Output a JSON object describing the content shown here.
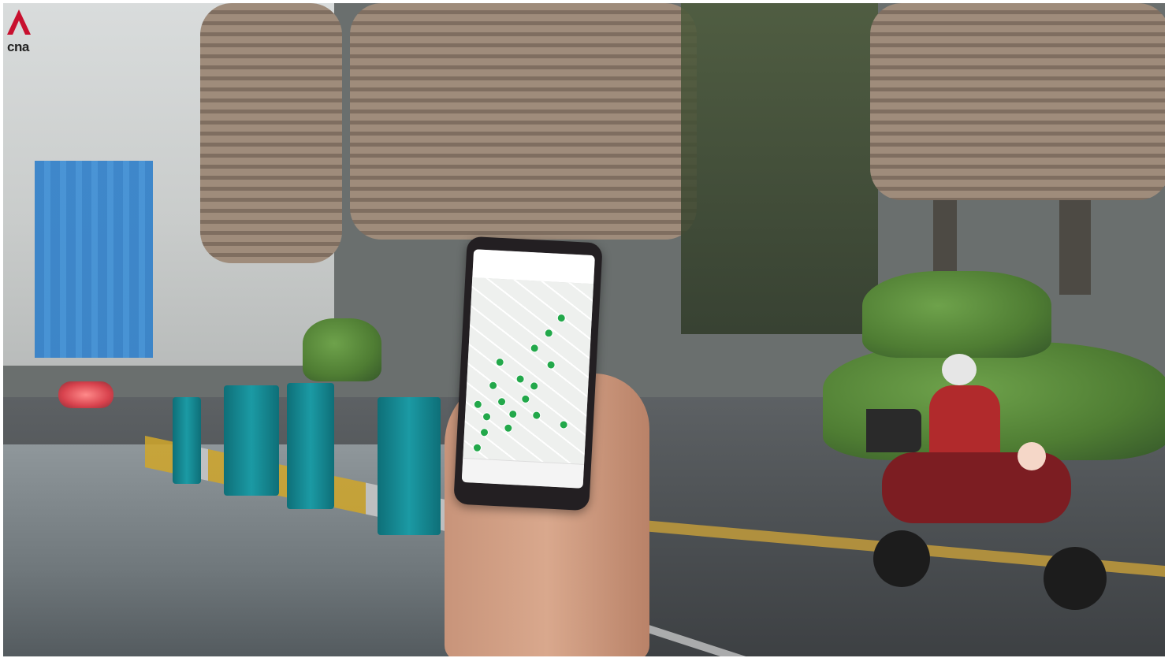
{
  "image": {
    "description_free": true,
    "logo_text": "cna",
    "colors": {
      "logo_red": "#c8102e",
      "pin_green": "#22a84a",
      "bollard_teal": "#1b9aa4"
    },
    "map_pin_count": 18
  }
}
